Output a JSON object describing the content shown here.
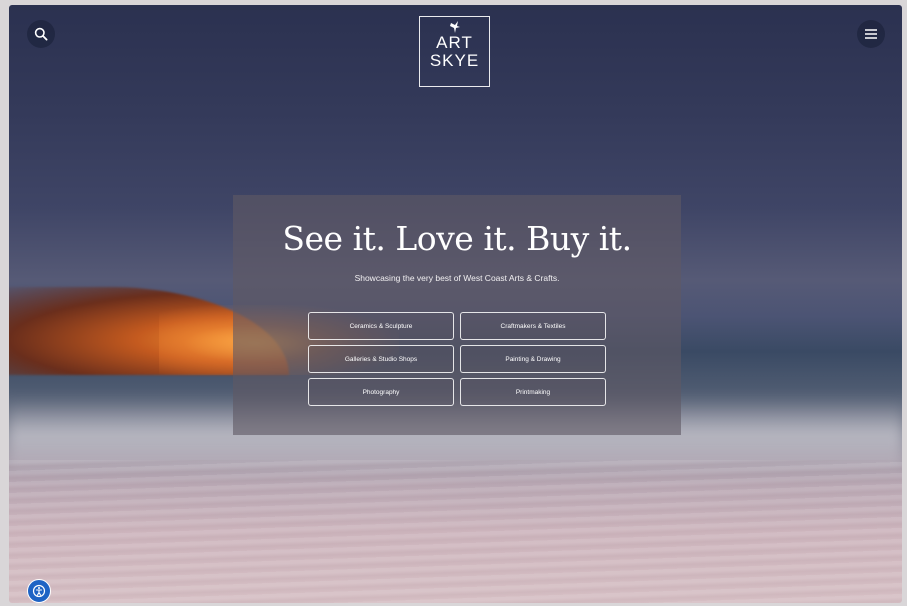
{
  "header": {
    "search_icon": "search-icon",
    "menu_icon": "hamburger-menu-icon",
    "logo": {
      "line1": "ART",
      "line2": "SKYE",
      "emblem_icon": "bird-icon"
    }
  },
  "hero": {
    "headline": "See it. Love it. Buy it.",
    "tagline": "Showcasing the very best of West Coast Arts & Crafts.",
    "categories": [
      {
        "label": "Ceramics & Sculpture"
      },
      {
        "label": "Craftmakers & Textiles"
      },
      {
        "label": "Galleries & Studio Shops"
      },
      {
        "label": "Painting & Drawing"
      },
      {
        "label": "Photography"
      },
      {
        "label": "Printmaking"
      }
    ]
  },
  "accessibility": {
    "icon": "accessibility-icon"
  },
  "colors": {
    "accent_blue": "#1e63c4",
    "sky_dark": "#2b3150",
    "glow_orange": "#f49a36"
  }
}
